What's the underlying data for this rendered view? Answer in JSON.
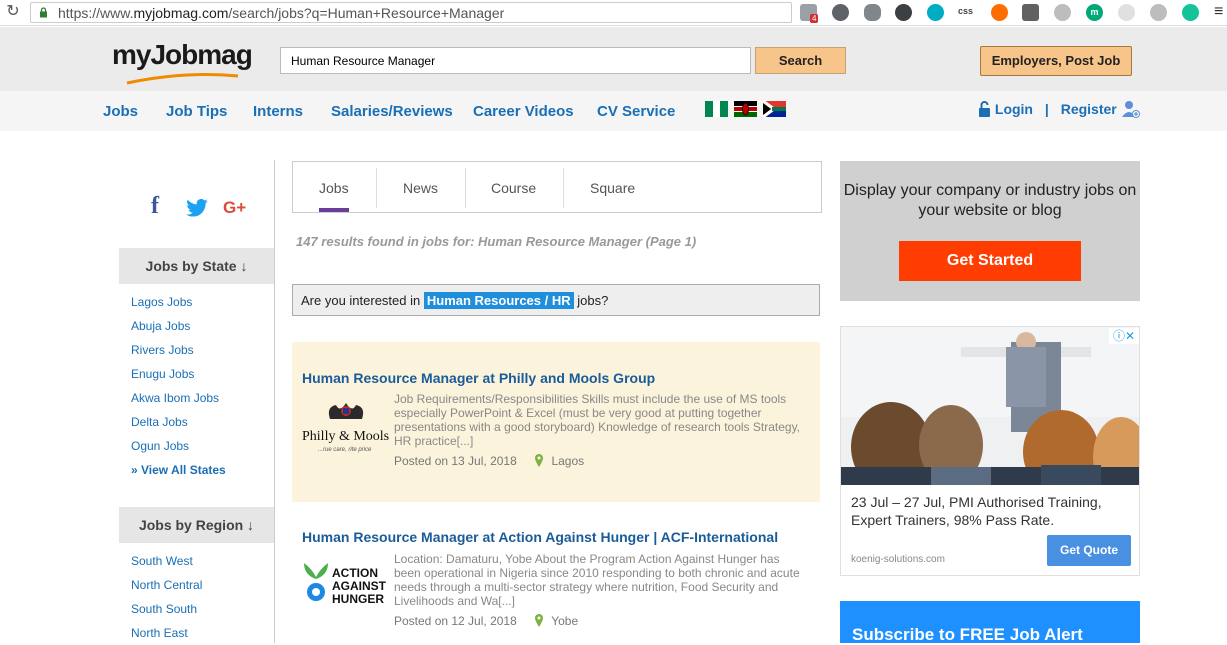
{
  "browser": {
    "url_scheme": "https://www.",
    "url_host": "myjobmag.com",
    "url_path": "/search/jobs?q=Human+Resource+Manager",
    "extension_badge": "4",
    "ext_css_label": "css",
    "ext_m_label": "m"
  },
  "header": {
    "logo_main": "my",
    "logo_accent": "Jobmag",
    "search_value": "Human Resource Manager",
    "search_button": "Search",
    "employers_button": "Employers, Post Job"
  },
  "nav": {
    "items": [
      "Jobs",
      "Job Tips",
      "Interns",
      "Salaries/Reviews",
      "Career Videos",
      "CV Service"
    ],
    "login": "Login",
    "separator": "|",
    "register": "Register"
  },
  "sidebar": {
    "social": [
      "f",
      "G+"
    ],
    "state_heading": "Jobs by State ↓",
    "states": [
      "Lagos Jobs",
      "Abuja Jobs",
      "Rivers Jobs",
      "Enugu Jobs",
      "Akwa Ibom Jobs",
      "Delta Jobs",
      "Ogun Jobs",
      "» View All States"
    ],
    "region_heading": "Jobs by Region ↓",
    "regions": [
      "South West",
      "North Central",
      "South South",
      "North East"
    ]
  },
  "tabs": [
    "Jobs",
    "News",
    "Course",
    "Square"
  ],
  "results_text": "147 results found in jobs for: Human Resource Manager (Page 1)",
  "interest": {
    "prefix": "Are you interested in",
    "highlight": "Human Resources / HR",
    "suffix": "jobs?"
  },
  "jobs": [
    {
      "title": "Human Resource Manager at Philly and Mools Group",
      "logo_text": "Philly & Mools",
      "logo_tag": "...rue care, rite price",
      "description": "Job Requirements/Responsibilities Skills must include the use of MS tools especially PowerPoint & Excel (must be very good at putting together presentations with a good storyboard) Knowledge of research tools Strategy, HR practice[...]",
      "posted": "Posted on 13 Jul, 2018",
      "location": "Lagos",
      "bg": "#fbf3dc"
    },
    {
      "title": "Human Resource Manager at Action Against Hunger | ACF-International",
      "logo_text": "ACTION AGAINST HUNGER",
      "logo_tag": "",
      "description": "Location: Damaturu, Yobe About the Program Action Against Hunger has been operational in Nigeria since 2010 responding to both chronic and acute needs through a multi-sector strategy where nutrition, Food Security and Livelihoods and Wa[...]",
      "posted": "Posted on 12 Jul, 2018",
      "location": "Yobe",
      "bg": "#ffffff"
    }
  ],
  "promo": {
    "text": "Display your company or industry jobs on your website or blog",
    "button": "Get Started"
  },
  "ad": {
    "text": "23 Jul – 27 Jul, PMI Authorised Training, Expert Trainers, 98% Pass Rate.",
    "domain": "koenig-solutions.com",
    "button": "Get Quote",
    "close": "ⓘ✕"
  },
  "alert": {
    "text": "Subscribe to FREE Job Alert"
  },
  "colors": {
    "link": "#1a6fb5",
    "accent": "#f7c48a",
    "get_started": "#ff3d00",
    "alert": "#1e90ff"
  }
}
